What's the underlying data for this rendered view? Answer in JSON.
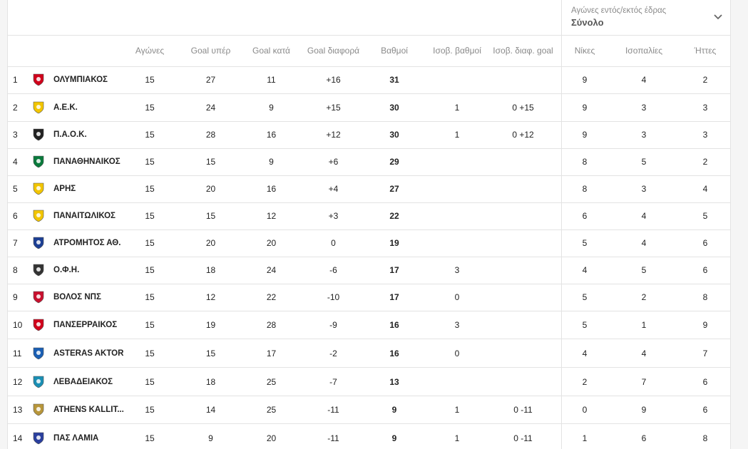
{
  "filter": {
    "label": "Αγώνες εντός/εκτός έδρας",
    "value": "Σύνολο"
  },
  "columns": {
    "played": "Αγώνες",
    "goals_for": "Goal υπέρ",
    "goals_against": "Goal κατά",
    "goal_diff": "Goal διαφορά",
    "points": "Βαθμοί",
    "tie_points": "Ισοβ. βαθμοί",
    "tie_gd": "Ισοβ. διαφ. goal",
    "wins": "Νίκες",
    "draws": "Ισοπαλίες",
    "losses": "Ήττες"
  },
  "rows": [
    {
      "pos": "1",
      "team": "ΟΛΥΜΠΙΑΚΟΣ",
      "played": "15",
      "gf": "27",
      "ga": "11",
      "gd": "+16",
      "pts": "31",
      "tpts": "",
      "tgd": "",
      "w": "9",
      "d": "4",
      "l": "2",
      "logo_color": "#d0021b",
      "logo_icon": "olympiakos-crest-icon"
    },
    {
      "pos": "2",
      "team": "Α.Ε.Κ.",
      "played": "15",
      "gf": "24",
      "ga": "9",
      "gd": "+15",
      "pts": "30",
      "tpts": "1",
      "tgd": "0 +15",
      "w": "9",
      "d": "3",
      "l": "3",
      "logo_color": "#f2c500",
      "logo_icon": "aek-crest-icon"
    },
    {
      "pos": "3",
      "team": "Π.Α.Ο.Κ.",
      "played": "15",
      "gf": "28",
      "ga": "16",
      "gd": "+12",
      "pts": "30",
      "tpts": "1",
      "tgd": "0 +12",
      "w": "9",
      "d": "3",
      "l": "3",
      "logo_color": "#222222",
      "logo_icon": "paok-crest-icon"
    },
    {
      "pos": "4",
      "team": "ΠΑΝΑΘΗΝΑΙΚΟΣ",
      "played": "15",
      "gf": "15",
      "ga": "9",
      "gd": "+6",
      "pts": "29",
      "tpts": "",
      "tgd": "",
      "w": "8",
      "d": "5",
      "l": "2",
      "logo_color": "#0a7a3c",
      "logo_icon": "panathinaikos-crest-icon"
    },
    {
      "pos": "5",
      "team": "ΑΡΗΣ",
      "played": "15",
      "gf": "20",
      "ga": "16",
      "gd": "+4",
      "pts": "27",
      "tpts": "",
      "tgd": "",
      "w": "8",
      "d": "3",
      "l": "4",
      "logo_color": "#f2c500",
      "logo_icon": "aris-crest-icon"
    },
    {
      "pos": "6",
      "team": "ΠΑΝΑΙΤΩΛΙΚΟΣ",
      "played": "15",
      "gf": "15",
      "ga": "12",
      "gd": "+3",
      "pts": "22",
      "tpts": "",
      "tgd": "",
      "w": "6",
      "d": "4",
      "l": "5",
      "logo_color": "#f2c500",
      "logo_icon": "panetolikos-crest-icon"
    },
    {
      "pos": "7",
      "team": "ΑΤΡΟΜΗΤΟΣ ΑΘ.",
      "played": "15",
      "gf": "20",
      "ga": "20",
      "gd": "0",
      "pts": "19",
      "tpts": "",
      "tgd": "",
      "w": "5",
      "d": "4",
      "l": "6",
      "logo_color": "#1c3f94",
      "logo_icon": "atromitos-crest-icon"
    },
    {
      "pos": "8",
      "team": "Ο.Φ.Η.",
      "played": "15",
      "gf": "18",
      "ga": "24",
      "gd": "-6",
      "pts": "17",
      "tpts": "3",
      "tgd": "",
      "w": "4",
      "d": "5",
      "l": "6",
      "logo_color": "#333333",
      "logo_icon": "ofi-crest-icon"
    },
    {
      "pos": "9",
      "team": "ΒΟΛΟΣ ΝΠΣ",
      "played": "15",
      "gf": "12",
      "ga": "22",
      "gd": "-10",
      "pts": "17",
      "tpts": "0",
      "tgd": "",
      "w": "5",
      "d": "2",
      "l": "8",
      "logo_color": "#c8102e",
      "logo_icon": "volos-crest-icon"
    },
    {
      "pos": "10",
      "team": "ΠΑΝΣΕΡΡΑΙΚΟΣ",
      "played": "15",
      "gf": "19",
      "ga": "28",
      "gd": "-9",
      "pts": "16",
      "tpts": "3",
      "tgd": "",
      "w": "5",
      "d": "1",
      "l": "9",
      "logo_color": "#d0021b",
      "logo_icon": "panserraikos-crest-icon"
    },
    {
      "pos": "11",
      "team": "ASTERAS AKTOR",
      "played": "15",
      "gf": "15",
      "ga": "17",
      "gd": "-2",
      "pts": "16",
      "tpts": "0",
      "tgd": "",
      "w": "4",
      "d": "4",
      "l": "7",
      "logo_color": "#1a5fb4",
      "logo_icon": "asteras-crest-icon"
    },
    {
      "pos": "12",
      "team": "ΛΕΒΑΔΕΙΑΚΟΣ",
      "played": "15",
      "gf": "18",
      "ga": "25",
      "gd": "-7",
      "pts": "13",
      "tpts": "",
      "tgd": "",
      "w": "2",
      "d": "7",
      "l": "6",
      "logo_color": "#1a8fb4",
      "logo_icon": "levadiakos-crest-icon"
    },
    {
      "pos": "13",
      "team": "ATHENS KALLIT...",
      "played": "15",
      "gf": "14",
      "ga": "25",
      "gd": "-11",
      "pts": "9",
      "tpts": "1",
      "tgd": "0 -11",
      "w": "0",
      "d": "9",
      "l": "6",
      "logo_color": "#b8963a",
      "logo_icon": "athens-kallithea-crest-icon"
    },
    {
      "pos": "14",
      "team": "ΠΑΣ ΛΑΜΙΑ",
      "played": "15",
      "gf": "9",
      "ga": "20",
      "gd": "-11",
      "pts": "9",
      "tpts": "1",
      "tgd": "0 -11",
      "w": "1",
      "d": "6",
      "l": "8",
      "logo_color": "#2a3f9e",
      "logo_icon": "lamia-crest-icon"
    }
  ]
}
